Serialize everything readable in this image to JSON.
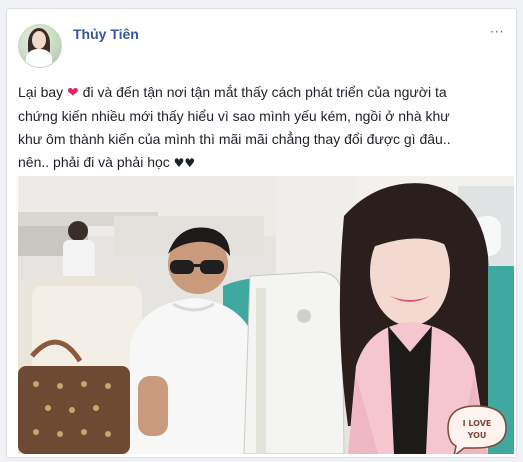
{
  "post": {
    "author": "Thủy Tiên",
    "more_options": "···",
    "lines": [
      {
        "before": "Lại bay ",
        "heart": "❤",
        "after": " đi và đến tận nơi tận mắt thấy cách phát triển của người ta"
      },
      {
        "text": "chứng kiến nhiều mới thấy hiểu vì sao mình yếu kém, ngồi ở nhà khư"
      },
      {
        "text": "khư ôm thành kiến của mình thì mãi mãi chẳng thay đổi được gì đâu.."
      },
      {
        "before": "nên.. phải đi và phải học ",
        "hearts": "♥♥"
      }
    ],
    "photo": {
      "sticker_line1": "I LOVE",
      "sticker_line2": "YOU"
    }
  },
  "colors": {
    "author_link": "#365899",
    "text": "#1d2129",
    "heart": "#e0245e",
    "card_border": "#dddfe2",
    "pink_jacket": "#f5c6cf",
    "seat_teal": "#3fa9a0"
  }
}
